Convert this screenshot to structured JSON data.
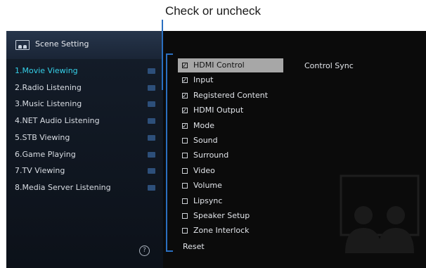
{
  "callout": {
    "text": "Check or uncheck"
  },
  "header": {
    "title": "Scene Setting"
  },
  "scenes": [
    {
      "label": "1.Movie Viewing",
      "selected": true
    },
    {
      "label": "2.Radio Listening",
      "selected": false
    },
    {
      "label": "3.Music Listening",
      "selected": false
    },
    {
      "label": "4.NET Audio Listening",
      "selected": false
    },
    {
      "label": "5.STB Viewing",
      "selected": false
    },
    {
      "label": "6.Game Playing",
      "selected": false
    },
    {
      "label": "7.TV Viewing",
      "selected": false
    },
    {
      "label": "8.Media Server Listening",
      "selected": false
    }
  ],
  "options": [
    {
      "label": "HDMI Control",
      "checked": true,
      "highlighted": true
    },
    {
      "label": "Input",
      "checked": true,
      "highlighted": false
    },
    {
      "label": "Registered Content",
      "checked": true,
      "highlighted": false
    },
    {
      "label": "HDMI Output",
      "checked": true,
      "highlighted": false
    },
    {
      "label": "Mode",
      "checked": true,
      "highlighted": false
    },
    {
      "label": "Sound",
      "checked": false,
      "highlighted": false
    },
    {
      "label": "Surround",
      "checked": false,
      "highlighted": false
    },
    {
      "label": "Video",
      "checked": false,
      "highlighted": false
    },
    {
      "label": "Volume",
      "checked": false,
      "highlighted": false
    },
    {
      "label": "Lipsync",
      "checked": false,
      "highlighted": false
    },
    {
      "label": "Speaker Setup",
      "checked": false,
      "highlighted": false
    },
    {
      "label": "Zone Interlock",
      "checked": false,
      "highlighted": false
    }
  ],
  "reset_label": "Reset",
  "description": "Control Sync",
  "help_symbol": "?",
  "colors": {
    "accent": "#35d0e8",
    "bracket": "#2a6fc0",
    "highlight": "#a7a7a7"
  },
  "icons": {
    "header": "scene-icon",
    "scene_items": "scene-folder-icon",
    "help": "help-icon"
  }
}
